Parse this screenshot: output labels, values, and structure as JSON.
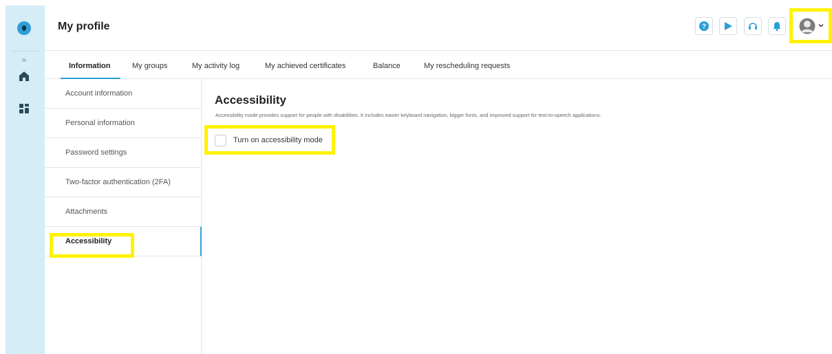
{
  "header": {
    "title": "My profile",
    "icons": [
      "help-icon",
      "play-icon",
      "headset-icon",
      "bell-icon",
      "avatar-icon",
      "chevron-down-icon"
    ],
    "accent": "#2a9fd6"
  },
  "tabs": [
    {
      "label": "Information"
    },
    {
      "label": "My groups"
    },
    {
      "label": "My activity log"
    },
    {
      "label": "My achieved certificates"
    },
    {
      "label": "Balance"
    },
    {
      "label": "My rescheduling requests"
    }
  ],
  "sidebar": {
    "items": [
      {
        "label": "Account information"
      },
      {
        "label": "Personal information"
      },
      {
        "label": "Password settings"
      },
      {
        "label": "Two-factor authentication (2FA)"
      },
      {
        "label": "Attachments"
      },
      {
        "label": "Accessibility"
      }
    ]
  },
  "content": {
    "title": "Accessibility",
    "description": "Accessibility mode provides support for people with disabilities. It includes easier keyboard navigation, bigger fonts, and improved support for text-to-speech applications.",
    "toggle_label": "Turn on accessibility mode"
  },
  "rail": {
    "icons": [
      "logo-icon",
      "expand-icon",
      "home-icon",
      "dashboard-icon"
    ]
  }
}
